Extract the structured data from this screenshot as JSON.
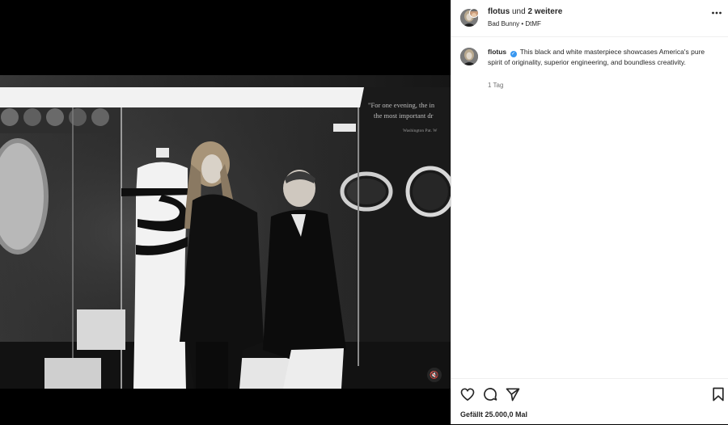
{
  "post": {
    "header": {
      "author": "flotus",
      "connector": " und ",
      "coauthors": "2 weitere",
      "audio": "Bad Bunny",
      "separator": " • ",
      "song": "DtMF",
      "more_icon": "more-horizontal-icon"
    },
    "caption": {
      "author": "flotus",
      "text": "This black and white masterpiece showcases America's pure spirit of originality, superior engineering, and boundless creativity.",
      "time": "1 Tag"
    },
    "media": {
      "mute_icon": "speaker-muted-icon",
      "mute_glyph": "🔇",
      "exhibit_quote_line1": "\"For one evening, the in",
      "exhibit_quote_line2": "the most important dr",
      "exhibit_quote_line3": "Washington Pat. W"
    },
    "actions": {
      "icons": [
        "heart-icon",
        "comment-icon",
        "share-icon",
        "bookmark-icon"
      ],
      "likes": "Gefällt 25.000,0 Mal"
    },
    "colors": {
      "accent_verified": "#3897f0",
      "text_primary": "#262626",
      "text_secondary": "#737373",
      "panel_bg": "#ffffff",
      "media_bg": "#000000"
    }
  }
}
